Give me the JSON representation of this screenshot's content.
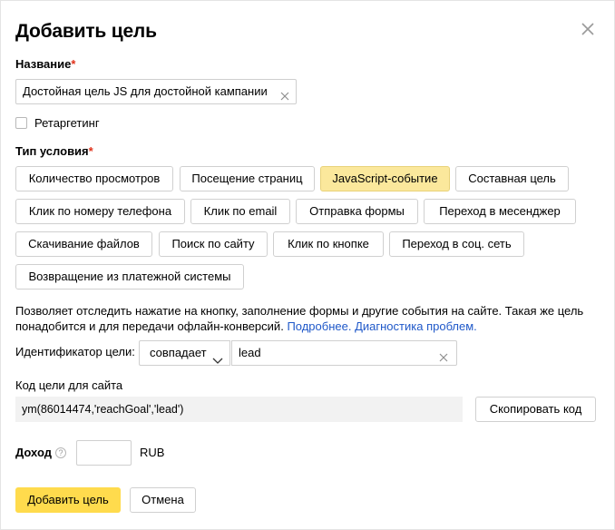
{
  "dialog": {
    "title": "Добавить цель",
    "close_icon": "close-icon"
  },
  "name": {
    "label": "Название",
    "required_mark": "*",
    "value": "Достойная цель JS для достойной кампании"
  },
  "retargeting": {
    "label": "Ретаргетинг",
    "checked": false
  },
  "condition_type": {
    "label": "Тип условия",
    "required_mark": "*",
    "options": [
      "Количество просмотров",
      "Посещение страниц",
      "JavaScript-событие",
      "Составная цель",
      "Клик по номеру телефона",
      "Клик по email",
      "Отправка формы",
      "Переход в месенджер",
      "Скачивание файлов",
      "Поиск по сайту",
      "Клик по кнопке",
      "Переход в соц. сеть",
      "Возвращение из платежной системы"
    ],
    "selected": "JavaScript-событие"
  },
  "description": {
    "text": "Позволяет отследить нажатие на кнопку, заполнение формы и другие события на сайте. Такая же цель понадобится и для передачи офлайн-конверсий.",
    "link_more": "Подробнее.",
    "link_diagnostics": "Диагностика проблем."
  },
  "identifier": {
    "label": "Идентификатор цели:",
    "match_type": "совпадает",
    "value": "lead"
  },
  "code": {
    "label": "Код цели для сайта",
    "value": "ym(86014474,'reachGoal','lead')",
    "copy_label": "Скопировать код"
  },
  "income": {
    "label": "Доход",
    "help_glyph": "?",
    "value": "",
    "currency": "RUB"
  },
  "footer": {
    "submit_label": "Добавить цель",
    "cancel_label": "Отмена"
  },
  "colors": {
    "accent": "#ffdb4d",
    "chip_active": "#fbe89c",
    "link": "#1f58c9",
    "required": "#e0311a"
  }
}
